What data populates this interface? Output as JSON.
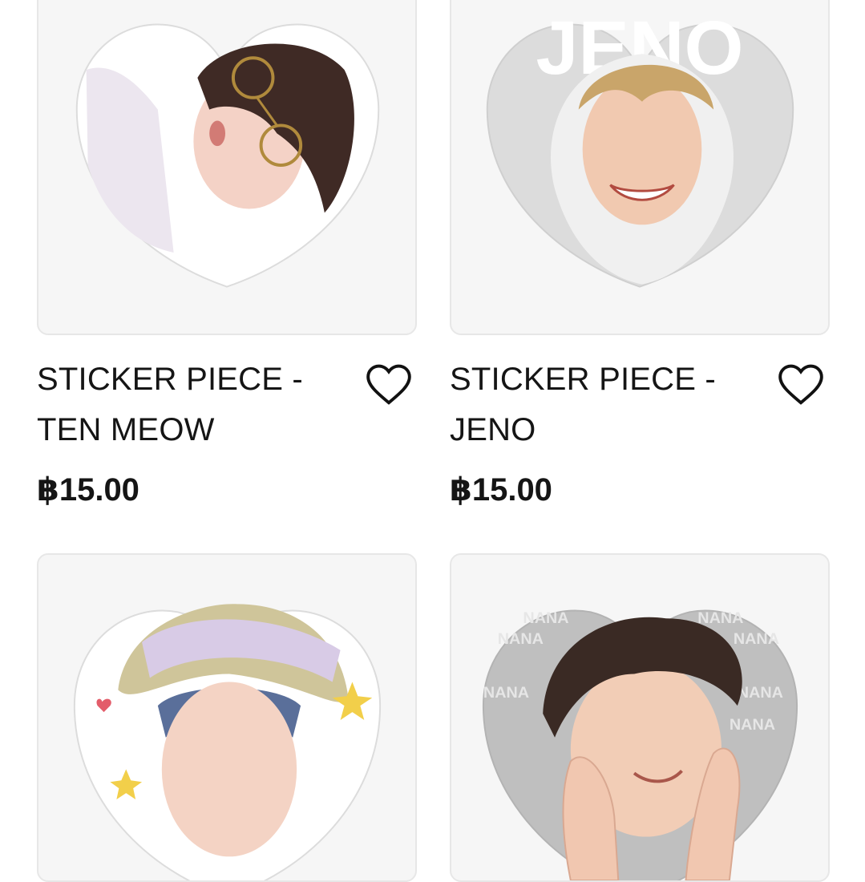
{
  "products": [
    {
      "title_line1": "STICKER PIECE -",
      "title_line2": "TEN MEOW",
      "price": "฿15.00",
      "image_icon": "heart-sticker-portrait-glasses"
    },
    {
      "title_line1": "STICKER PIECE -",
      "title_line2": "JENO",
      "price": "฿15.00",
      "image_icon": "heart-sticker-portrait-hood",
      "image_text": "JENO"
    },
    {
      "image_icon": "heart-sticker-portrait-headband"
    },
    {
      "image_icon": "heart-sticker-portrait-hands",
      "image_text": "NANA"
    }
  ],
  "colors": {
    "card_bg": "#f6f6f6",
    "card_border": "#e7e7e7",
    "text": "#151515"
  }
}
